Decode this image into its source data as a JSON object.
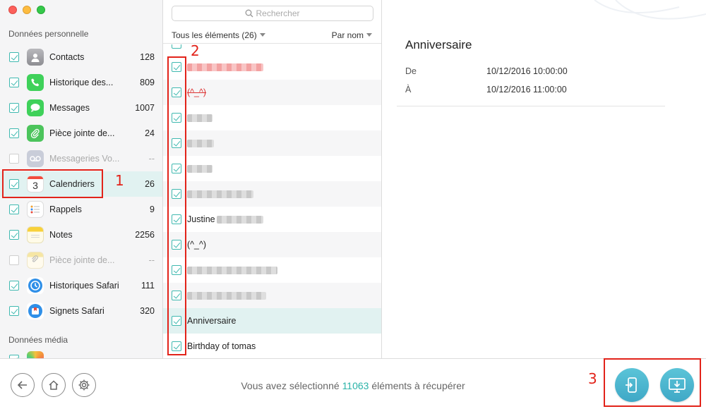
{
  "sidebar": {
    "section_personal": "Données personnelle",
    "section_media": "Données média",
    "items": [
      {
        "label": "Contacts",
        "count": "128"
      },
      {
        "label": "Historique des...",
        "count": "809"
      },
      {
        "label": "Messages",
        "count": "1007"
      },
      {
        "label": "Pièce jointe de...",
        "count": "24"
      },
      {
        "label": "Messageries Vo...",
        "count": "--"
      },
      {
        "label": "Calendriers",
        "count": "26",
        "icon_text": "3"
      },
      {
        "label": "Rappels",
        "count": "9"
      },
      {
        "label": "Notes",
        "count": "2256"
      },
      {
        "label": "Pièce jointe de...",
        "count": "--"
      },
      {
        "label": "Historiques Safari",
        "count": "111"
      },
      {
        "label": "Signets Safari",
        "count": "320"
      }
    ]
  },
  "list": {
    "search_placeholder": "Rechercher",
    "filter_label": "Tous les éléments (26)",
    "sort_label": "Par nom",
    "rows": [
      {
        "label": ""
      },
      {
        "label": "(^_^)"
      },
      {
        "label": ""
      },
      {
        "label": ""
      },
      {
        "label": ""
      },
      {
        "label": ""
      },
      {
        "label": "Justine"
      },
      {
        "label": "(^_^)"
      },
      {
        "label": ""
      },
      {
        "label": ""
      },
      {
        "label": "Anniversaire"
      },
      {
        "label": "Birthday of tomas"
      }
    ]
  },
  "detail": {
    "title": "Anniversaire",
    "from_label": "De",
    "from_value": "10/12/2016 10:00:00",
    "to_label": "À",
    "to_value": "10/12/2016 11:00:00"
  },
  "bottom": {
    "status_prefix": "Vous avez sélectionné",
    "status_count": "11063",
    "status_suffix": "éléments à récupérer"
  },
  "annotations": {
    "n1": "1",
    "n2": "2",
    "n3": "3"
  },
  "colors": {
    "accent": "#40b9b0",
    "annotation": "#e2231a",
    "selected_bg": "#e1f2f1"
  }
}
